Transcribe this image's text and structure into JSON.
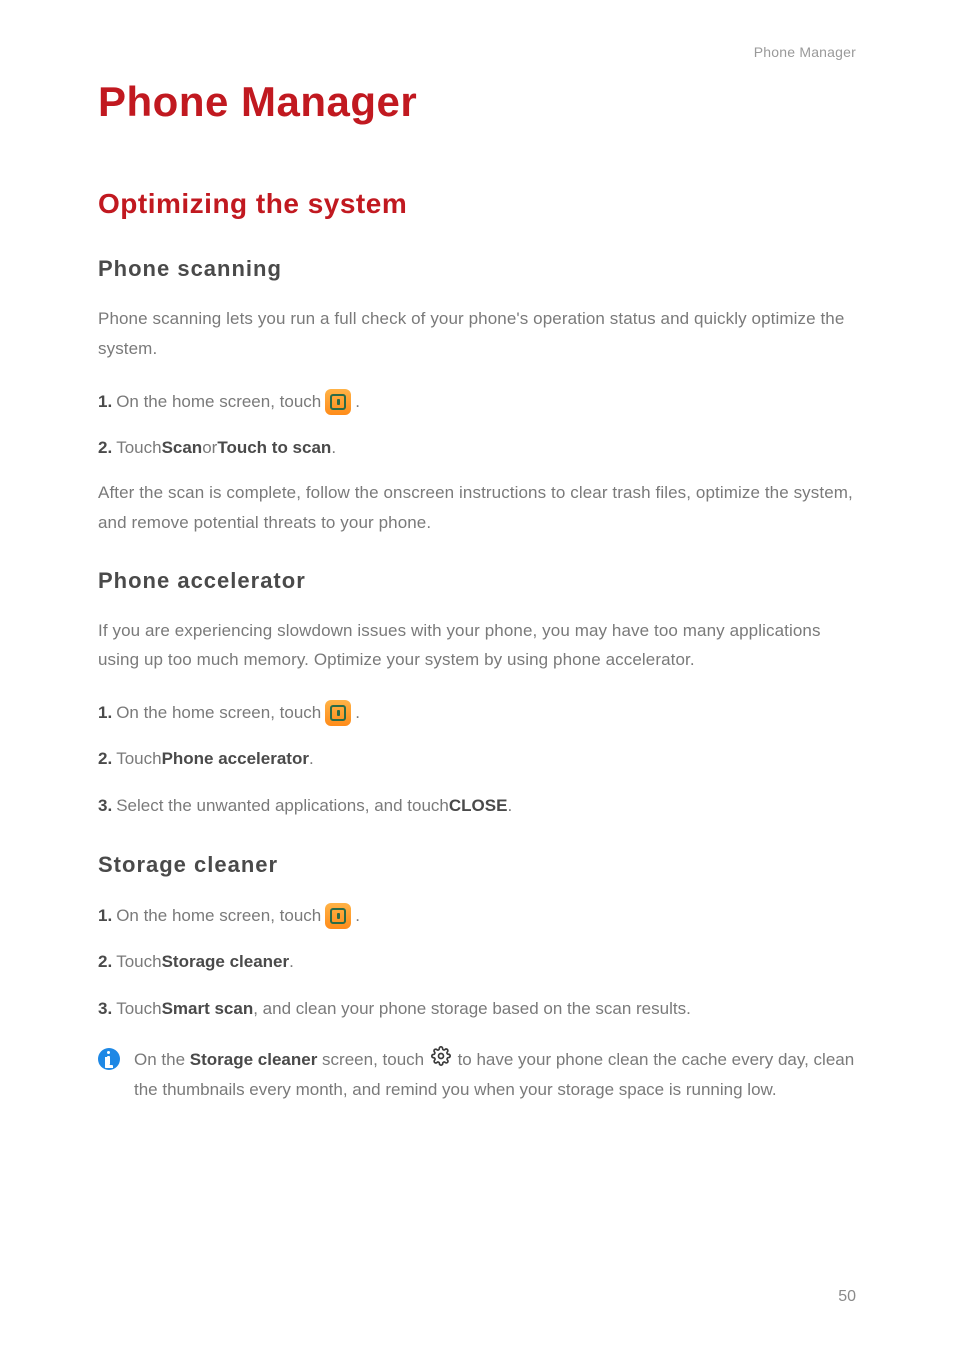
{
  "header": {
    "category": "Phone Manager"
  },
  "chapter": {
    "title": "Phone Manager"
  },
  "section": {
    "title": "Optimizing the system"
  },
  "phoneScanning": {
    "heading": "Phone  scanning",
    "intro": "Phone scanning lets you run a full check of your phone's operation status and quickly optimize the system.",
    "step1_prefix": "1.",
    "step1_text": " On the home screen, touch ",
    "step1_suffix": ".",
    "step2_prefix": "2.",
    "step2_a": " Touch ",
    "step2_b": "Scan",
    "step2_c": " or ",
    "step2_d": "Touch to scan",
    "step2_e": ".",
    "after": "After the scan is complete, follow the onscreen instructions to clear trash files, optimize the system, and remove potential threats to your phone."
  },
  "phoneAccelerator": {
    "heading": "Phone  accelerator",
    "intro": "If you are experiencing slowdown issues with your phone, you may have too many applications using up too much memory. Optimize your system by using phone accelerator.",
    "step1_prefix": "1.",
    "step1_text": " On the home screen, touch ",
    "step1_suffix": ".",
    "step2_prefix": "2.",
    "step2_a": " Touch ",
    "step2_b": "Phone accelerator",
    "step2_c": ".",
    "step3_prefix": "3.",
    "step3_a": " Select the unwanted applications, and touch ",
    "step3_b": "CLOSE",
    "step3_c": "."
  },
  "storageCleaner": {
    "heading": "Storage  cleaner",
    "step1_prefix": "1.",
    "step1_text": " On the home screen, touch ",
    "step1_suffix": ".",
    "step2_prefix": "2.",
    "step2_a": " Touch ",
    "step2_b": "Storage cleaner",
    "step2_c": ".",
    "step3_prefix": "3.",
    "step3_a": " Touch ",
    "step3_b": "Smart scan",
    "step3_c": ", and clean your phone storage based on the scan results.",
    "info_a": "On the ",
    "info_b": "Storage cleaner",
    "info_c": " screen, touch ",
    "info_d": " to have your phone clean the cache every day, clean the thumbnails every month, and remind you when your storage space is running low."
  },
  "pageNumber": "50",
  "icons": {
    "app": "phone-manager-app-icon",
    "settings": "settings-gear-icon",
    "info": "info-icon"
  }
}
